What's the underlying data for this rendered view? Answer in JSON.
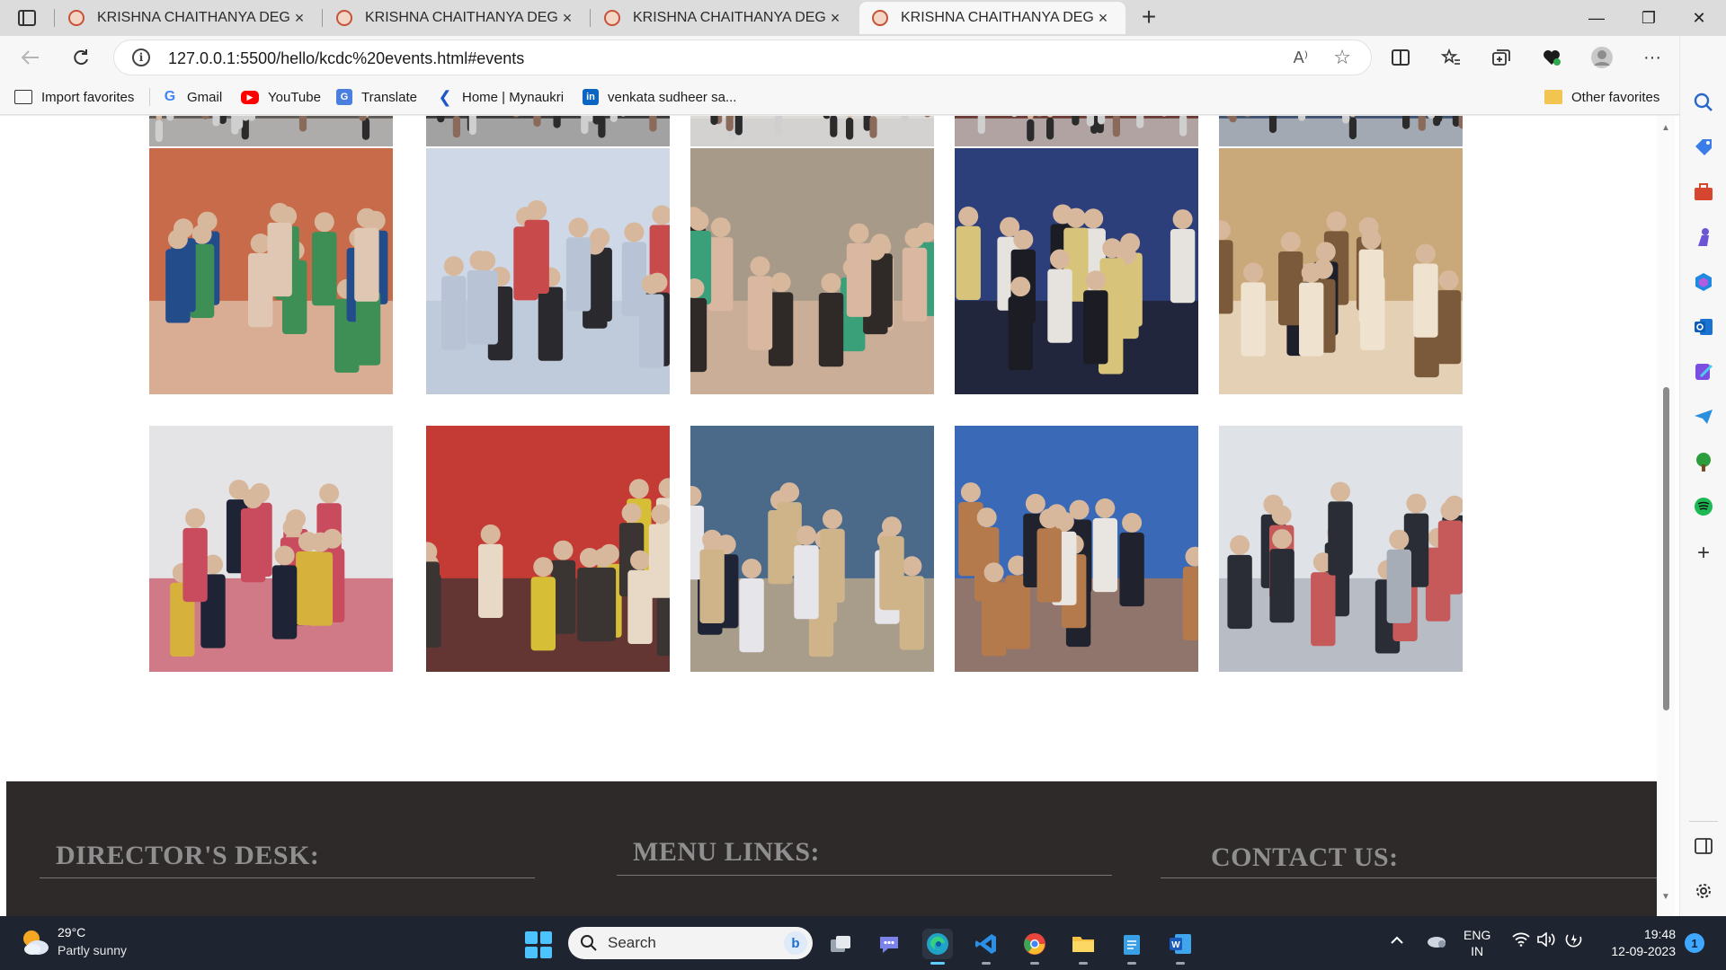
{
  "browser": {
    "tabs": [
      {
        "title": "KRISHNA CHAITHANYA DEGREE"
      },
      {
        "title": "KRISHNA CHAITHANYA DEGREE"
      },
      {
        "title": "KRISHNA CHAITHANYA DEGREE"
      },
      {
        "title": "KRISHNA CHAITHANYA DEGREE"
      }
    ],
    "active_tab_index": 3,
    "url": "127.0.0.1:5500/hello/kcdc%20events.html#events",
    "favorites": [
      {
        "label": "Import favorites",
        "icon": "import-icon"
      },
      {
        "label": "Gmail",
        "icon": "google-icon"
      },
      {
        "label": "YouTube",
        "icon": "youtube-icon"
      },
      {
        "label": "Translate",
        "icon": "translate-icon"
      },
      {
        "label": "Home | Mynaukri",
        "icon": "mynaukri-icon"
      },
      {
        "label": "venkata sudheer sa...",
        "icon": "linkedin-icon"
      }
    ],
    "other_favorites": "Other favorites",
    "read_aloud_label": "A⁾",
    "window_controls": {
      "minimize": "—",
      "maximize": "❐",
      "close": "✕"
    }
  },
  "page": {
    "gallery_top_row_count": 5,
    "gallery_photos": [
      {
        "scene": "press-interview"
      },
      {
        "scene": "conference-room-group"
      },
      {
        "scene": "students-portrait"
      },
      {
        "scene": "auditorium-group"
      },
      {
        "scene": "students-in-suits"
      },
      {
        "scene": "group-photo-hall"
      },
      {
        "scene": "blood-donation-interview"
      },
      {
        "scene": "library-reading"
      },
      {
        "scene": "meeting-hall"
      },
      {
        "scene": "computer-lab"
      }
    ],
    "footer": {
      "directors_desk": "DIRECTOR'S DESK:",
      "menu_links": "MENU LINKS:",
      "contact_us": "CONTACT US:"
    }
  },
  "taskbar": {
    "weather_temp": "29°C",
    "weather_desc": "Partly sunny",
    "search_label": "Search",
    "search_badge": "b",
    "lang_line1": "ENG",
    "lang_line2": "IN",
    "time": "19:48",
    "date": "12-09-2023",
    "notification_count": "1",
    "apps": [
      "task-view",
      "teams-chat",
      "edge",
      "vscode",
      "chrome",
      "file-explorer",
      "notepad",
      "word"
    ]
  },
  "colors": {
    "footer_bg": "#2f2a2a",
    "footer_heading": "#8f8f8f",
    "taskbar_bg": "#1e2430",
    "accent": "#2a76d2"
  }
}
